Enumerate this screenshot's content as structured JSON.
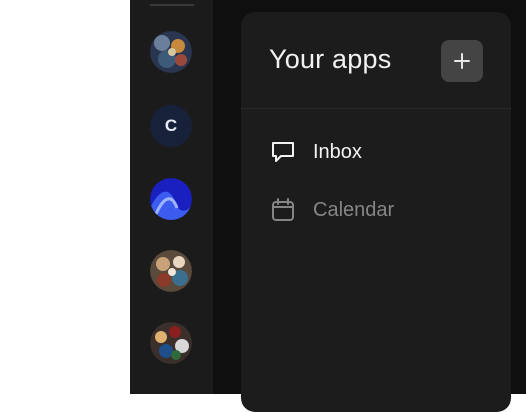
{
  "panel": {
    "title": "Your apps",
    "add_button": {
      "icon": "plus-icon"
    }
  },
  "apps": [
    {
      "label": "Inbox",
      "icon": "chat-bubble-icon",
      "active": true
    },
    {
      "label": "Calendar",
      "icon": "calendar-icon",
      "active": false
    }
  ],
  "servers": [
    {
      "type": "image",
      "icon": "server-avatar-image"
    },
    {
      "type": "letter",
      "letter": "C"
    },
    {
      "type": "image",
      "icon": "server-avatar-image"
    },
    {
      "type": "image",
      "icon": "server-avatar-image"
    },
    {
      "type": "image",
      "icon": "server-avatar-image"
    }
  ],
  "colors": {
    "rail_bg": "#1b1b1b",
    "main_bg": "#0f0f0f",
    "panel_bg": "#1c1c1c",
    "add_button_bg": "#444444",
    "text_primary": "#f2f2f2",
    "text_muted": "#858585"
  }
}
